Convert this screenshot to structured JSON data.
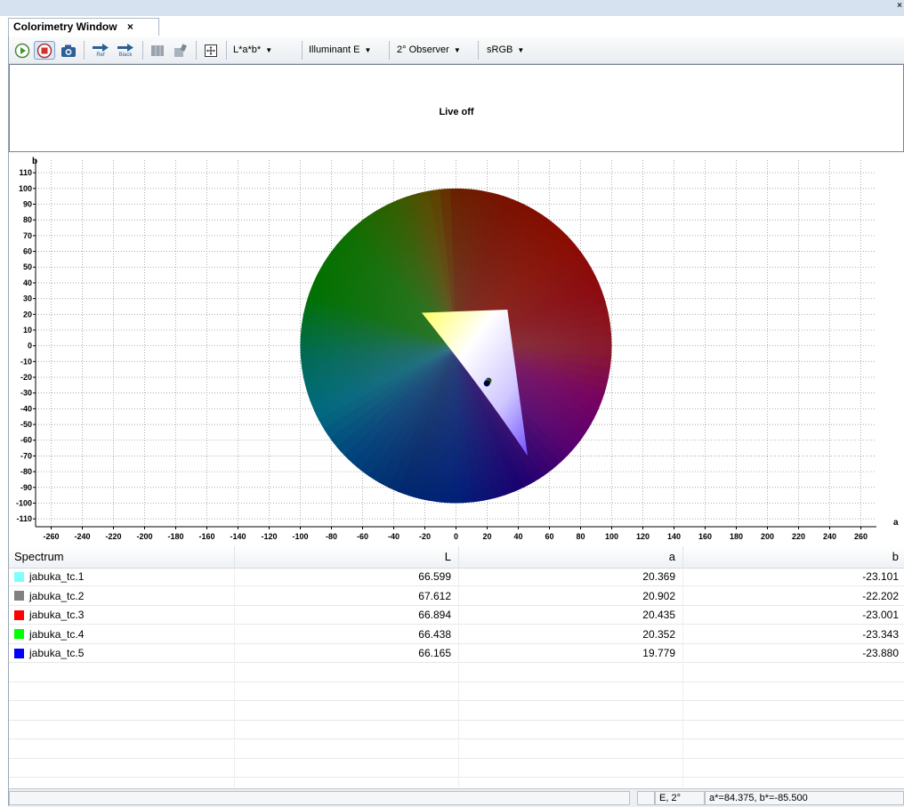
{
  "window": {
    "tab_title": "Colorimetry Window",
    "tab_close": "×"
  },
  "toolbar": {
    "icons": [
      "play-icon",
      "stop-icon",
      "camera-icon",
      "ref-arrow-icon",
      "black-arrow-icon",
      "grid-icon",
      "paint-icon",
      "fit-icon"
    ],
    "ref_label": "Ref",
    "black_label": "Black",
    "color_space": "L*a*b*",
    "illuminant": "Illuminant E",
    "observer": "2° Observer",
    "rgb_space": "sRGB"
  },
  "live": {
    "status_text": "Live off"
  },
  "chart_data": {
    "type": "scatter",
    "title": "",
    "xlabel": "a",
    "ylabel": "b",
    "xlim": [
      -270,
      270
    ],
    "ylim": [
      -115,
      118
    ],
    "x_ticks": [
      -260,
      -240,
      -220,
      -200,
      -180,
      -160,
      -140,
      -120,
      -100,
      -80,
      -60,
      -40,
      -20,
      0,
      20,
      40,
      60,
      80,
      100,
      120,
      140,
      160,
      180,
      200,
      220,
      240,
      260
    ],
    "y_ticks": [
      110,
      100,
      90,
      80,
      70,
      60,
      50,
      40,
      30,
      20,
      10,
      0,
      -10,
      -20,
      -30,
      -40,
      -50,
      -60,
      -70,
      -80,
      -90,
      -100,
      -110
    ],
    "grid": true,
    "gamut_disk_radius": 100,
    "gamut_triangle": [
      [
        -22,
        21
      ],
      [
        33,
        23
      ],
      [
        46,
        -70
      ]
    ],
    "series": [
      {
        "name": "jabuka_tc.1",
        "color": "#80ffff",
        "points": [
          [
            20.369,
            -23.101
          ]
        ]
      },
      {
        "name": "jabuka_tc.2",
        "color": "#808080",
        "points": [
          [
            20.902,
            -22.202
          ]
        ]
      },
      {
        "name": "jabuka_tc.3",
        "color": "#ff0000",
        "points": [
          [
            20.435,
            -23.001
          ]
        ]
      },
      {
        "name": "jabuka_tc.4",
        "color": "#00ff00",
        "points": [
          [
            20.352,
            -23.343
          ]
        ]
      },
      {
        "name": "jabuka_tc.5",
        "color": "#0000ff",
        "points": [
          [
            19.779,
            -23.88
          ]
        ]
      }
    ]
  },
  "table": {
    "headers": [
      "Spectrum",
      "L",
      "a",
      "b"
    ],
    "rows": [
      {
        "name": "jabuka_tc.1",
        "color": "#80ffff",
        "L": "66.599",
        "a": "20.369",
        "b": "-23.101"
      },
      {
        "name": "jabuka_tc.2",
        "color": "#808080",
        "L": "67.612",
        "a": "20.902",
        "b": "-22.202"
      },
      {
        "name": "jabuka_tc.3",
        "color": "#ff0000",
        "L": "66.894",
        "a": "20.435",
        "b": "-23.001"
      },
      {
        "name": "jabuka_tc.4",
        "color": "#00ff00",
        "L": "66.438",
        "a": "20.352",
        "b": "-23.343"
      },
      {
        "name": "jabuka_tc.5",
        "color": "#0000ff",
        "L": "66.165",
        "a": "19.779",
        "b": "-23.880"
      }
    ],
    "empty_rows": 7
  },
  "status": {
    "observer": "E, 2°",
    "cursor": "a*=84.375, b*=-85.500"
  }
}
